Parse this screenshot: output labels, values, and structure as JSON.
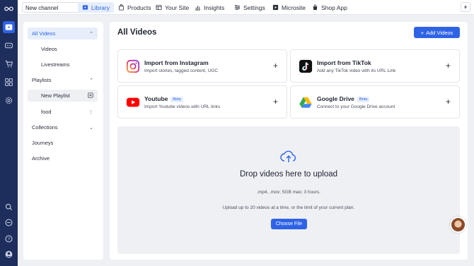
{
  "rail": {
    "icons": [
      "infinity-logo-icon",
      "play-icon",
      "chat-icon",
      "cart-icon",
      "grid-icon",
      "gear-icon",
      "search-icon",
      "message-icon",
      "help-icon",
      "user-icon"
    ]
  },
  "topbar": {
    "channel_label": "New channel",
    "nav": [
      {
        "label": "Library",
        "icon": "library-icon",
        "active": true
      },
      {
        "label": "Products",
        "icon": "bag-icon",
        "active": false
      },
      {
        "label": "Your Site",
        "icon": "site-icon",
        "active": false
      },
      {
        "label": "Insights",
        "icon": "chart-icon",
        "active": false
      },
      {
        "label": "Settings",
        "icon": "sliders-icon",
        "active": false
      },
      {
        "label": "Microsite",
        "icon": "play-square-icon",
        "active": false
      },
      {
        "label": "Shop App",
        "icon": "shop-icon",
        "active": false
      }
    ]
  },
  "sidebar": {
    "all_videos": "All Videos",
    "videos": "Videos",
    "livestreams": "Livestreams",
    "playlists": "Playlists",
    "new_playlist": "New Playlist",
    "food": "food",
    "collections": "Collections",
    "journeys": "Journeys",
    "archive": "Archive"
  },
  "main": {
    "title": "All Videos",
    "add_button": "Add Videos",
    "cards": {
      "instagram": {
        "title": "Import from Instagram",
        "desc": "Import stories, tagged content, UGC"
      },
      "tiktok": {
        "title": "Import from TikTok",
        "desc": "Add any TikTok video with its URL Link"
      },
      "youtube": {
        "title": "Youtube",
        "badge": "Beta",
        "desc": "Import Youtube videos with URL links"
      },
      "gdrive": {
        "title": "Google Drive",
        "badge": "Beta",
        "desc": "Connect to your Google Drive account"
      }
    },
    "drop": {
      "title": "Drop videos here to upload",
      "formats": ".mp4, .mov; 5GB max; 3 hours.",
      "limit": "Upload up to 20 videos at a time, or the limit of your current plan.",
      "choose": "Choose File"
    }
  },
  "colors": {
    "accent": "#2f63e6",
    "rail": "#1d2d5c"
  }
}
